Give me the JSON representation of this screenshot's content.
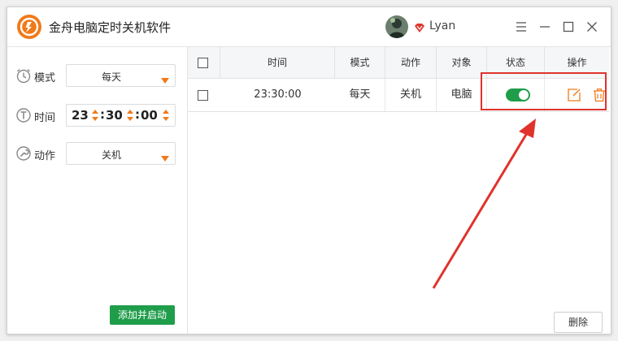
{
  "app": {
    "title": "金舟电脑定时关机软件",
    "accent_color": "#f07a1a",
    "green_color": "#1f9d4a",
    "logo_icon": "app-logo-icon"
  },
  "user": {
    "name": "Lyan",
    "badge_icon": "vip-diamond-icon"
  },
  "window_controls": {
    "menu_icon": "menu-icon",
    "minimize_icon": "minimize-icon",
    "maximize_icon": "maximize-icon",
    "close_icon": "close-icon"
  },
  "left_panel": {
    "mode": {
      "label": "模式",
      "value": "每天",
      "icon": "clock-icon"
    },
    "time": {
      "label": "时间",
      "hour": "23",
      "minute": "30",
      "second": "00",
      "icon": "timer-icon"
    },
    "action": {
      "label": "动作",
      "value": "关机",
      "icon": "wrench-icon"
    },
    "start_button": "添加并启动"
  },
  "table": {
    "columns": [
      "时间",
      "模式",
      "动作",
      "对象",
      "状态",
      "操作"
    ],
    "rows": [
      {
        "time": "23:30:00",
        "mode": "每天",
        "action": "关机",
        "target": "电脑",
        "status_on": true
      }
    ],
    "edit_icon": "edit-icon",
    "delete_icon": "trash-icon",
    "delete_button": "删除"
  },
  "annotation": {
    "highlight_color": "#e0332c"
  }
}
